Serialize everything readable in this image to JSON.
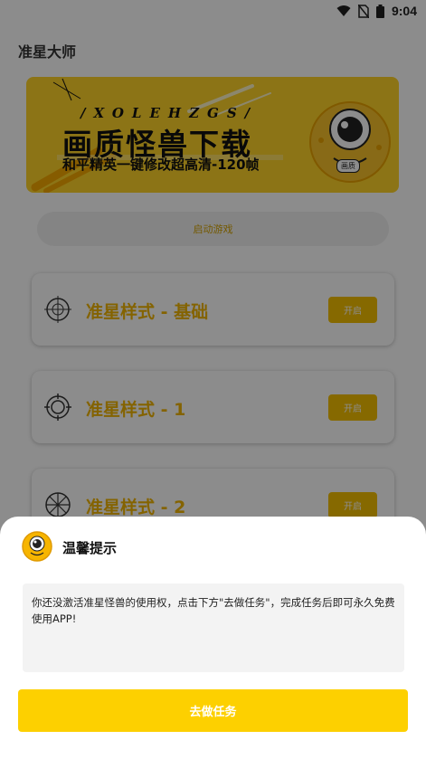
{
  "status_bar": {
    "time": "9:04"
  },
  "app": {
    "title": "准星大师",
    "banner": {
      "subtitle": "/XOLEHZGS/",
      "title": "画质怪兽下载",
      "description": "和平精英一键修改超高清-120帧",
      "badge": "画质"
    },
    "start_game_label": "启动游戏",
    "styles": [
      {
        "label": "准星样式 - 基础",
        "button": "开启",
        "icon": "crosshair-basic-icon"
      },
      {
        "label": "准星样式 - 1",
        "button": "开启",
        "icon": "crosshair-circle-icon"
      },
      {
        "label": "准星样式 - 2",
        "button": "开启",
        "icon": "crosshair-wheel-icon"
      }
    ]
  },
  "dialog": {
    "title": "温馨提示",
    "message": "你还没激活准星怪兽的使用权，点击下方\"去做任务\"，完成任务后即可永久免费使用APP!",
    "action_label": "去做任务"
  },
  "colors": {
    "accent": "#FDD000",
    "style_label": "#F0B400",
    "banner_bg": "#FFD428"
  }
}
